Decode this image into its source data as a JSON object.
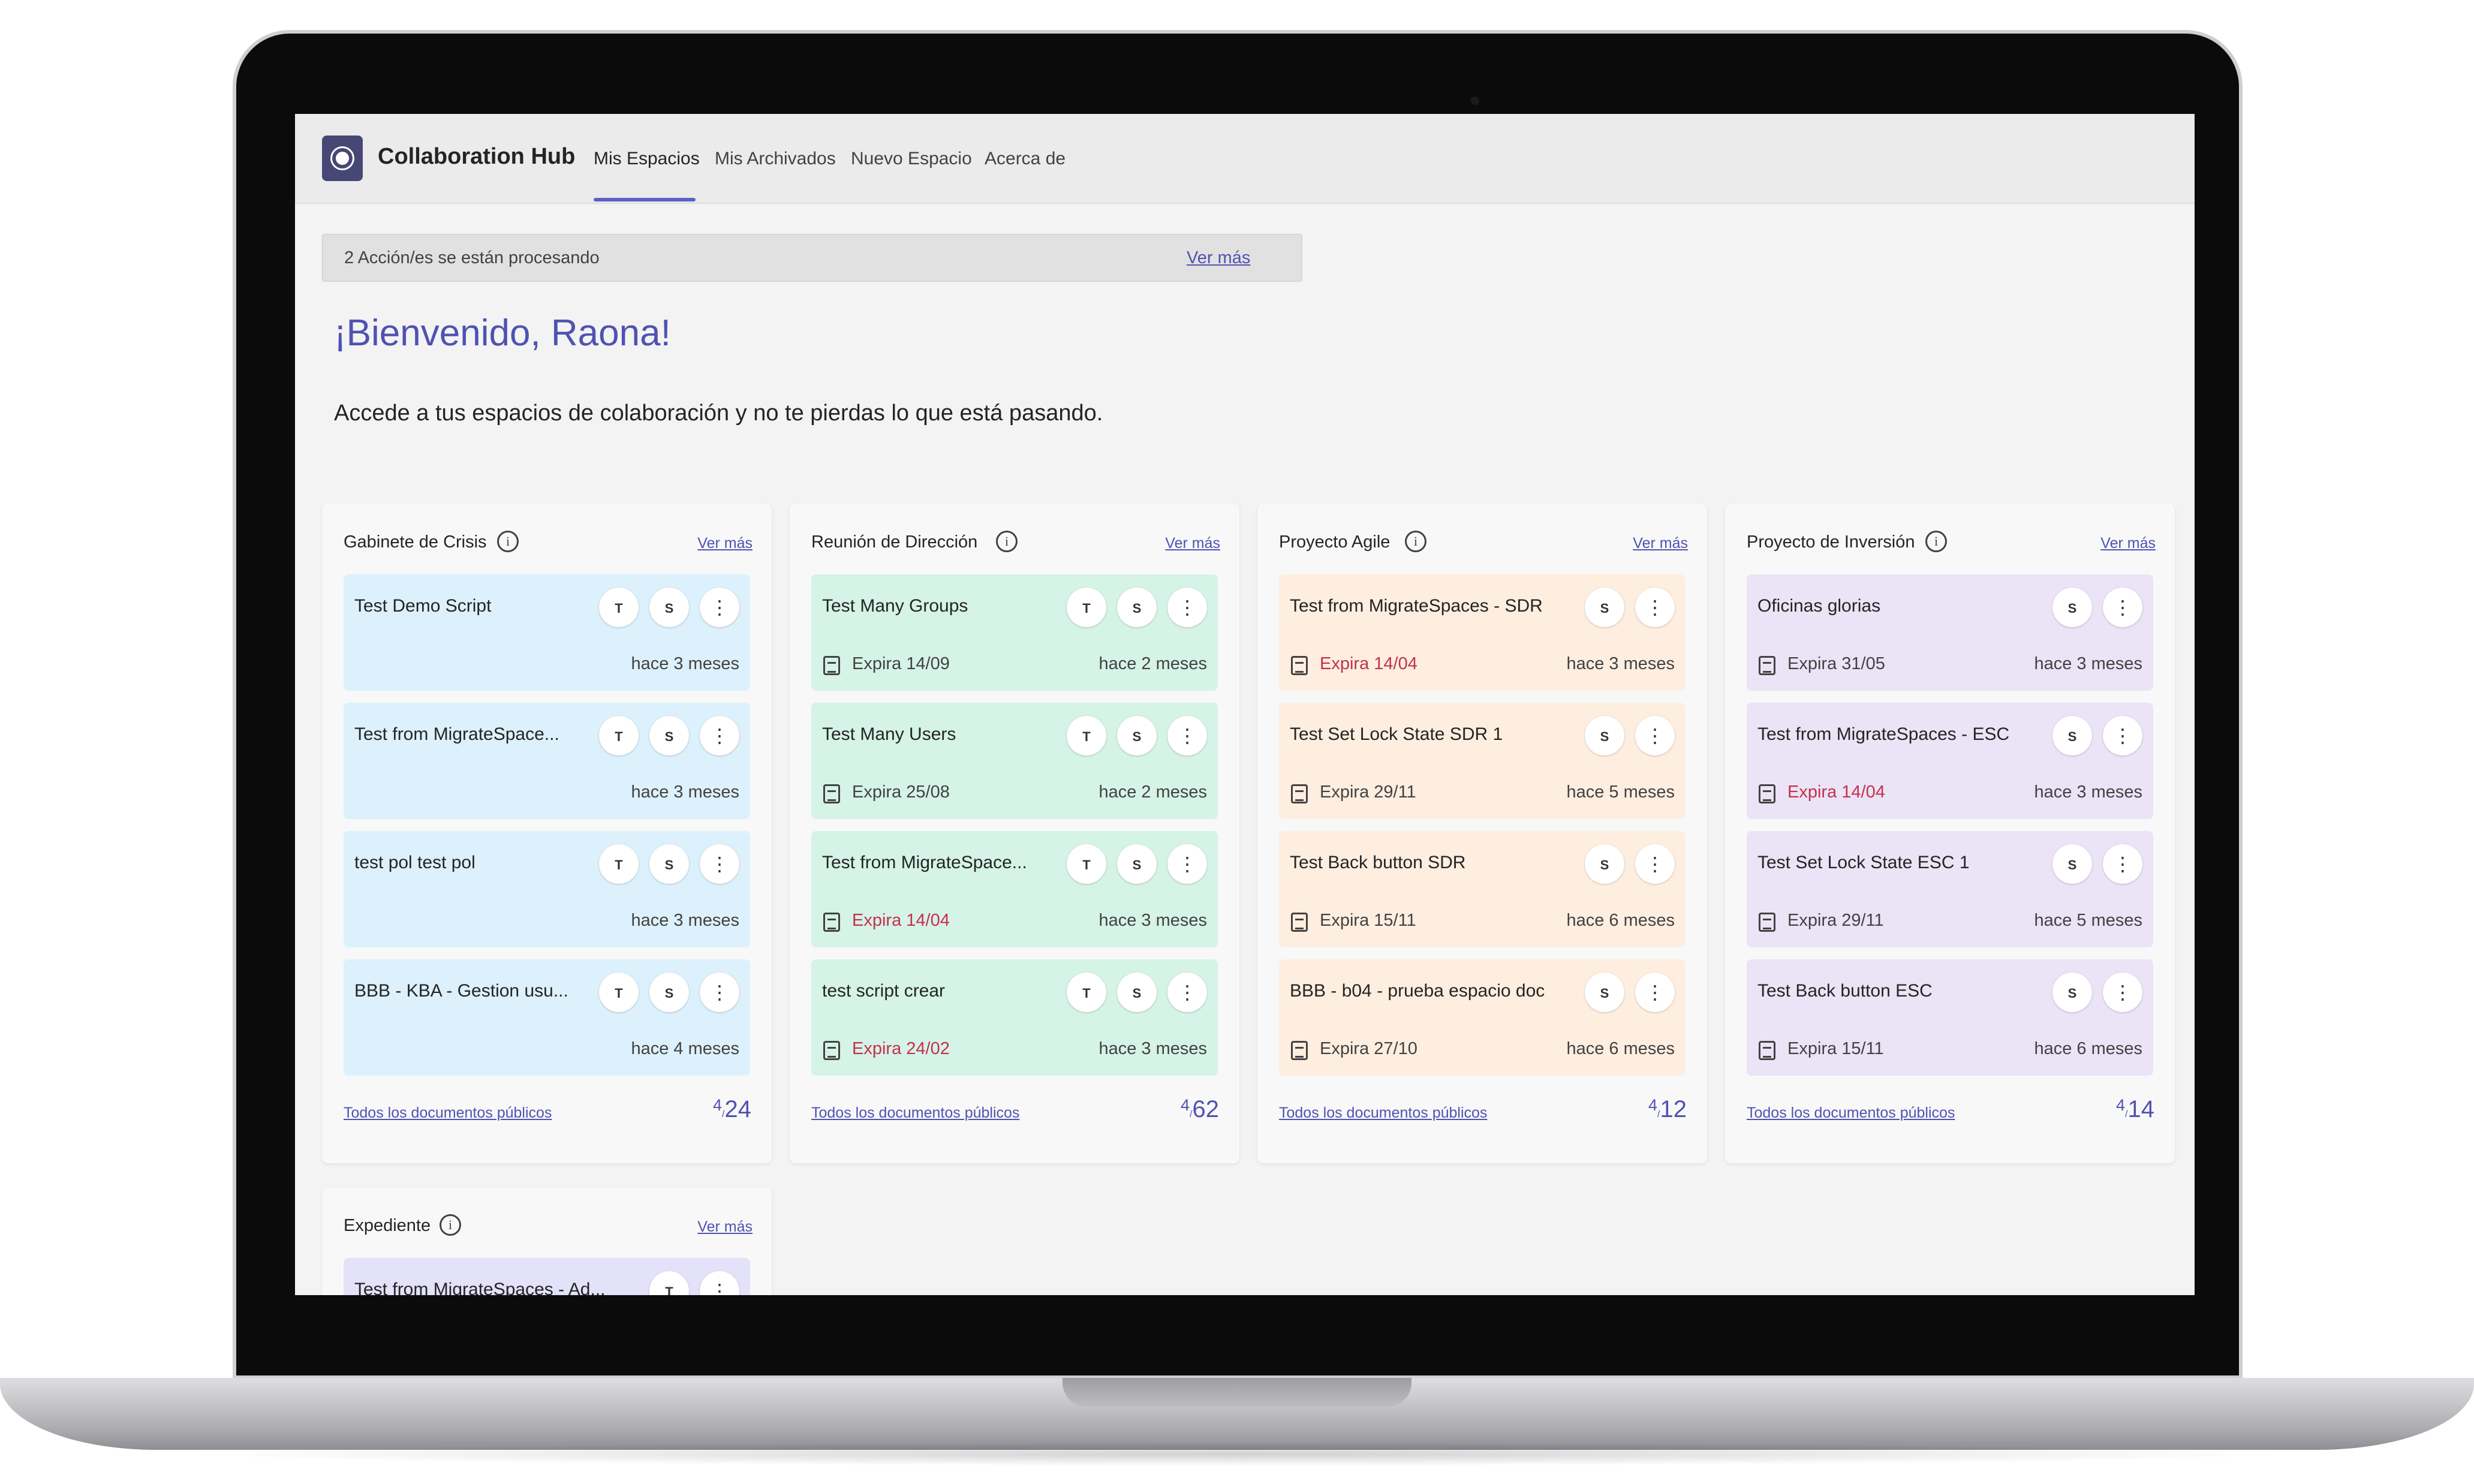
{
  "app": {
    "title": "Collaboration Hub",
    "tabs": [
      {
        "label": "Mis Espacios",
        "active": true
      },
      {
        "label": "Mis Archivados",
        "active": false
      },
      {
        "label": "Nuevo Espacio",
        "active": false
      },
      {
        "label": "Acerca de",
        "active": false
      }
    ]
  },
  "notice": {
    "text": "2 Acción/es se están procesando",
    "link": "Ver más"
  },
  "welcome": {
    "title": "¡Bienvenido, Raona!",
    "subtitle": "Accede a tus espacios de colaboración y no te pierdas lo que está pasando."
  },
  "columns": [
    {
      "title": "Gabinete de Crisis",
      "more": "Ver más",
      "footer_link": "Todos los documentos públicos",
      "count": "4",
      "total": "24",
      "color": "#dcf1fb",
      "cards": [
        {
          "name": "Test Demo Script",
          "time": "hace 3 meses"
        },
        {
          "name": "Test from MigrateSpace...",
          "time": "hace 3 meses"
        },
        {
          "name": "test pol test pol",
          "time": "hace 3 meses"
        },
        {
          "name": "BBB - KBA - Gestion usu...",
          "time": "hace 4 meses"
        }
      ]
    },
    {
      "title": "Reunión de Dirección",
      "more": "Ver más",
      "footer_link": "Todos los documentos públicos",
      "count": "4",
      "total": "62",
      "color": "#d5f3e7",
      "cards": [
        {
          "name": "Test Many Groups",
          "expiry": "Expira 14/09",
          "expired": false,
          "time": "hace 2 meses"
        },
        {
          "name": "Test Many Users",
          "expiry": "Expira 25/08",
          "expired": false,
          "time": "hace 2 meses"
        },
        {
          "name": "Test from MigrateSpace...",
          "expiry": "Expira 14/04",
          "expired": true,
          "time": "hace 3 meses"
        },
        {
          "name": "test script crear",
          "expiry": "Expira 24/02",
          "expired": true,
          "time": "hace 3 meses"
        }
      ]
    },
    {
      "title": "Proyecto Agile",
      "more": "Ver más",
      "footer_link": "Todos los documentos públicos",
      "count": "4",
      "total": "12",
      "color": "#fdeee0",
      "cards": [
        {
          "name": "Test from MigrateSpaces - SDR",
          "expiry": "Expira 14/04",
          "expired": true,
          "time": "hace 3 meses"
        },
        {
          "name": "Test Set Lock State SDR 1",
          "expiry": "Expira 29/11",
          "expired": false,
          "time": "hace 5 meses"
        },
        {
          "name": "Test Back button SDR",
          "expiry": "Expira 15/11",
          "expired": false,
          "time": "hace 6 meses"
        },
        {
          "name": "BBB - b04 - prueba espacio doc",
          "expiry": "Expira 27/10",
          "expired": false,
          "time": "hace 6 meses"
        }
      ]
    },
    {
      "title": "Proyecto de Inversión",
      "more": "Ver más",
      "footer_link": "Todos los documentos públicos",
      "count": "4",
      "total": "14",
      "color": "#ebe3f6",
      "cards": [
        {
          "name": "Oficinas glorias",
          "expiry": "Expira 31/05",
          "expired": false,
          "time": "hace 3 meses"
        },
        {
          "name": "Test from MigrateSpaces - ESC",
          "expiry": "Expira 14/04",
          "expired": true,
          "time": "hace 3 meses"
        },
        {
          "name": "Test Set Lock State ESC 1",
          "expiry": "Expira 29/11",
          "expired": false,
          "time": "hace 5 meses"
        },
        {
          "name": "Test Back button ESC",
          "expiry": "Expira 15/11",
          "expired": false,
          "time": "hace 6 meses"
        }
      ]
    },
    {
      "title": "Expediente",
      "more": "Ver más",
      "color": "#e3e2f9",
      "cards": [
        {
          "name": "Test from MigrateSpaces - Ad..."
        }
      ]
    }
  ],
  "icons": {
    "app_logo": "collaboration-hub-logo",
    "info": "info-icon",
    "teams": "teams-icon",
    "sharepoint": "sharepoint-icon",
    "more": "more-vertical-icon",
    "calendar": "calendar-icon"
  },
  "colors": {
    "accent": "#4f52b2",
    "expired": "#c4314b"
  }
}
